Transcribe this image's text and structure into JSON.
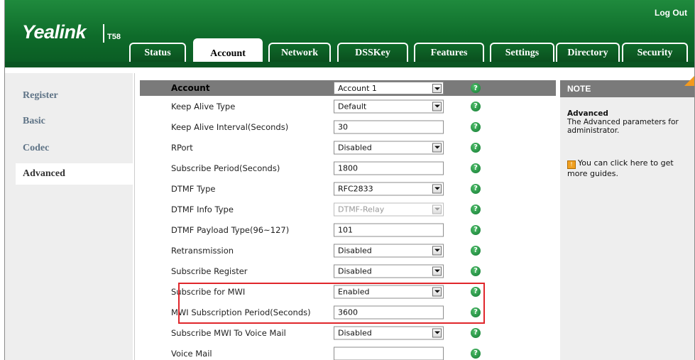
{
  "header": {
    "logo": "Yealink",
    "model": "T58",
    "logout": "Log Out"
  },
  "tabs": [
    {
      "label": "Status",
      "active": false
    },
    {
      "label": "Account",
      "active": true
    },
    {
      "label": "Network",
      "active": false
    },
    {
      "label": "DSSKey",
      "active": false
    },
    {
      "label": "Features",
      "active": false
    },
    {
      "label": "Settings",
      "active": false
    },
    {
      "label": "Directory",
      "active": false
    },
    {
      "label": "Security",
      "active": false
    }
  ],
  "sidebar": {
    "items": [
      {
        "label": "Register"
      },
      {
        "label": "Basic"
      },
      {
        "label": "Codec"
      },
      {
        "label": "Advanced",
        "selected": true
      }
    ]
  },
  "form": {
    "header": {
      "label": "Account",
      "value": "Account 1"
    },
    "rows": [
      {
        "label": "Keep Alive Type",
        "value": "Default",
        "type": "select"
      },
      {
        "label": "Keep Alive Interval(Seconds)",
        "value": "30",
        "type": "text"
      },
      {
        "label": "RPort",
        "value": "Disabled",
        "type": "select"
      },
      {
        "label": "Subscribe Period(Seconds)",
        "value": "1800",
        "type": "text"
      },
      {
        "label": "DTMF Type",
        "value": "RFC2833",
        "type": "select"
      },
      {
        "label": "DTMF Info Type",
        "value": "DTMF-Relay",
        "type": "select-disabled"
      },
      {
        "label": "DTMF Payload Type(96~127)",
        "value": "101",
        "type": "text"
      },
      {
        "label": "Retransmission",
        "value": "Disabled",
        "type": "select"
      },
      {
        "label": "Subscribe Register",
        "value": "Disabled",
        "type": "select"
      },
      {
        "label": "Subscribe for MWI",
        "value": "Enabled",
        "type": "select"
      },
      {
        "label": "MWI Subscription Period(Seconds)",
        "value": "3600",
        "type": "text"
      },
      {
        "label": "Subscribe MWI To Voice Mail",
        "value": "Disabled",
        "type": "select"
      },
      {
        "label": "Voice Mail",
        "value": "",
        "type": "text"
      }
    ],
    "help_glyph": "?"
  },
  "note": {
    "title": "NOTE",
    "subtitle": "Advanced",
    "description": "The Advanced parameters for administrator.",
    "guide_icon": "!",
    "guide": "You can click here to get more guides."
  },
  "colors": {
    "brand_green": "#0e6b2a",
    "header_gray": "#7a7a7a",
    "highlight_red": "#e0262b",
    "note_accent": "#f39a1e"
  }
}
